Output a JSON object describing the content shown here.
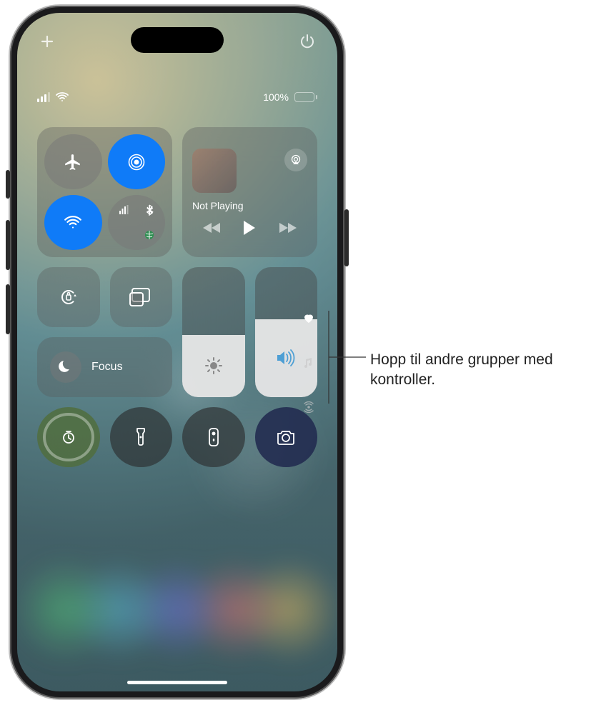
{
  "top": {
    "plus_icon": "plus",
    "power_icon": "power"
  },
  "status": {
    "signal_bars": 3,
    "battery_pct_label": "100%",
    "battery_pct": 100
  },
  "connectivity": {
    "airplane_mode": false,
    "airdrop": true,
    "wifi": true,
    "sub_cellular": true,
    "sub_bluetooth": true,
    "sub_satellite": true
  },
  "music": {
    "status_label": "Not Playing"
  },
  "focus": {
    "label": "Focus"
  },
  "sliders": {
    "brightness_pct": 48,
    "volume_pct": 60
  },
  "page_indicator": {
    "active": 0,
    "items": [
      "favorites",
      "music",
      "connectivity"
    ]
  },
  "callout": {
    "text": "Hopp til andre grupper med kontroller."
  }
}
